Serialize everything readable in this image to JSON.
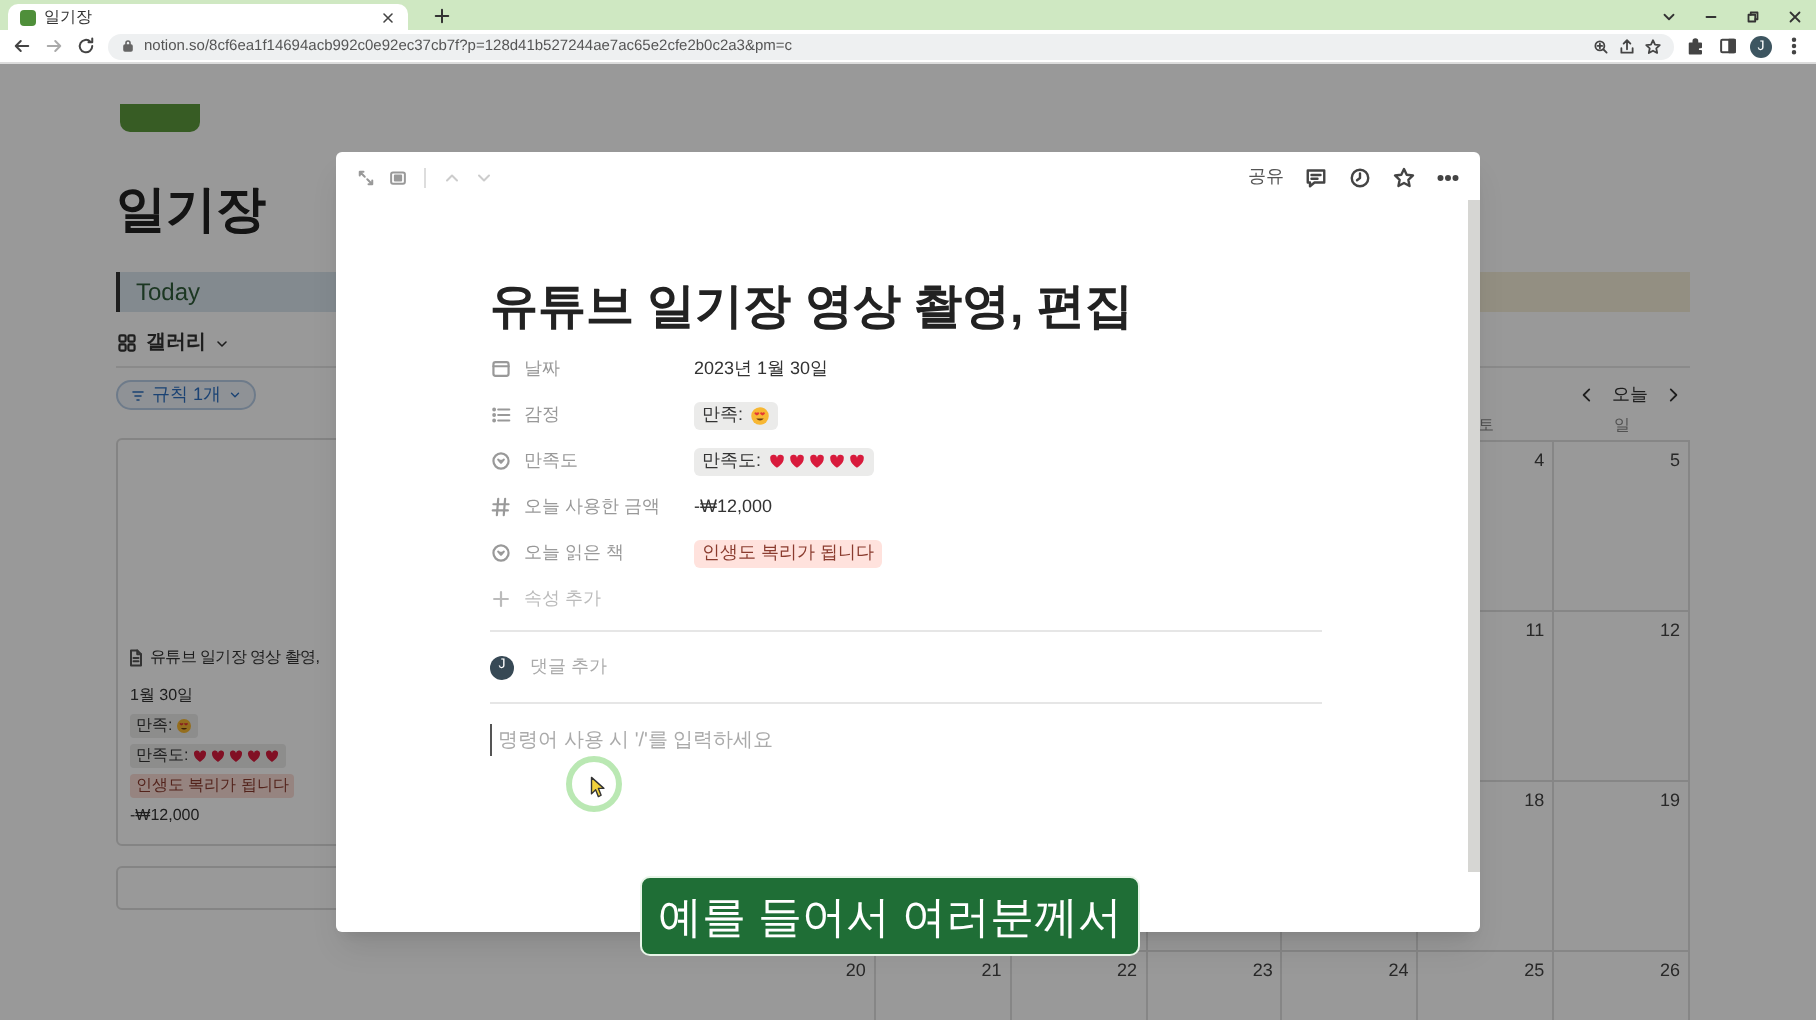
{
  "browser": {
    "tab_title": "일기장",
    "url": "notion.so/8cf6ea1f14694acb992c0e92ec37cb7f?p=128d41b527244ae7ac65e2cfe2b0c2a3&pm=c",
    "avatar": "J"
  },
  "page": {
    "title": "일기장",
    "view_bar": "Today",
    "view": "갤러리",
    "filter": "규칙 1개",
    "card": {
      "title": "유튜브 일기장 영상 촬영,",
      "date": "1월 30일",
      "mood": "만족:",
      "rating_label": "만족도:",
      "stars": 5,
      "book": "인생도 복리가 됩니다",
      "amount": "-₩12,000"
    },
    "calendar": {
      "today_button": "오늘",
      "weekdays": [
        "토",
        "일"
      ],
      "weeks": [
        [
          "4",
          "5"
        ],
        [
          "11",
          "12"
        ],
        [
          "18",
          "19"
        ],
        [
          "20",
          "21",
          "22",
          "23",
          "24",
          "25",
          "26"
        ]
      ]
    }
  },
  "modal": {
    "share": "공유",
    "title": "유튜브 일기장 영상 촬영, 편집",
    "properties": [
      {
        "kind": "date",
        "label": "날짜",
        "value": "2023년 1월 30일"
      },
      {
        "kind": "mood",
        "label": "감정",
        "value": "만족:",
        "color": "#ebebea"
      },
      {
        "kind": "rating",
        "label": "만족도",
        "value": "만족도:",
        "stars": 5,
        "color": "#ebebea"
      },
      {
        "kind": "number",
        "label": "오늘 사용한 금액",
        "value": "-₩12,000"
      },
      {
        "kind": "book",
        "label": "오늘 읽은 책",
        "value": "인생도 복리가 됩니다",
        "color": "#ffe2dd"
      }
    ],
    "add_property": "속성 추가",
    "comment": {
      "avatar": "J",
      "placeholder": "댓글 추가"
    },
    "body_placeholder": "명령어 사용 시 '/'를 입력하세요"
  },
  "caption": "예를 들어서 여러분께서"
}
